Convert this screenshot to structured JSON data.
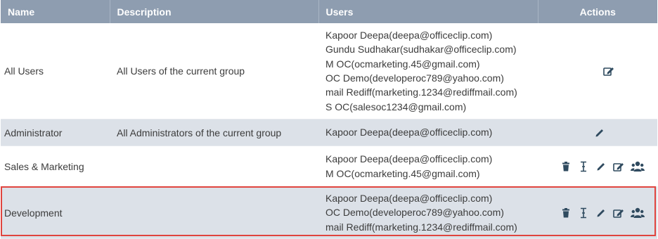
{
  "headers": {
    "name": "Name",
    "description": "Description",
    "users": "Users",
    "actions": "Actions"
  },
  "rows": [
    {
      "name": "All Users",
      "description": "All Users of the current group",
      "users": [
        "Kapoor Deepa(deepa@officeclip.com)",
        "Gundu Sudhakar(sudhakar@officeclip.com)",
        "M OC(ocmarketing.45@gmail.com)",
        "OC Demo(developeroc789@yahoo.com)",
        "mail Rediff(marketing.1234@rediffmail.com)",
        "S OC(salesoc1234@gmail.com)"
      ],
      "actions": [
        "edit-details-icon"
      ]
    },
    {
      "name": "Administrator",
      "description": "All Administrators of the current group",
      "users": [
        "Kapoor Deepa(deepa@officeclip.com)"
      ],
      "actions": [
        "pencil-icon"
      ]
    },
    {
      "name": "Sales & Marketing",
      "description": "",
      "users": [
        "Kapoor Deepa(deepa@officeclip.com)",
        "M OC(ocmarketing.45@gmail.com)"
      ],
      "actions": [
        "trash-icon",
        "text-cursor-icon",
        "pencil-icon",
        "edit-details-icon",
        "users-icon"
      ]
    },
    {
      "name": "Development",
      "description": "",
      "users": [
        "Kapoor Deepa(deepa@officeclip.com)",
        "OC Demo(developeroc789@yahoo.com)",
        "mail Rediff(marketing.1234@rediffmail.com)"
      ],
      "actions": [
        "trash-icon",
        "text-cursor-icon",
        "pencil-icon",
        "edit-details-icon",
        "users-icon"
      ]
    }
  ],
  "colors": {
    "header_bg": "#8e9db0",
    "alt_row_bg": "#dce1e8",
    "highlight_border": "#e0443e",
    "icon_color": "#2f4a5f"
  }
}
